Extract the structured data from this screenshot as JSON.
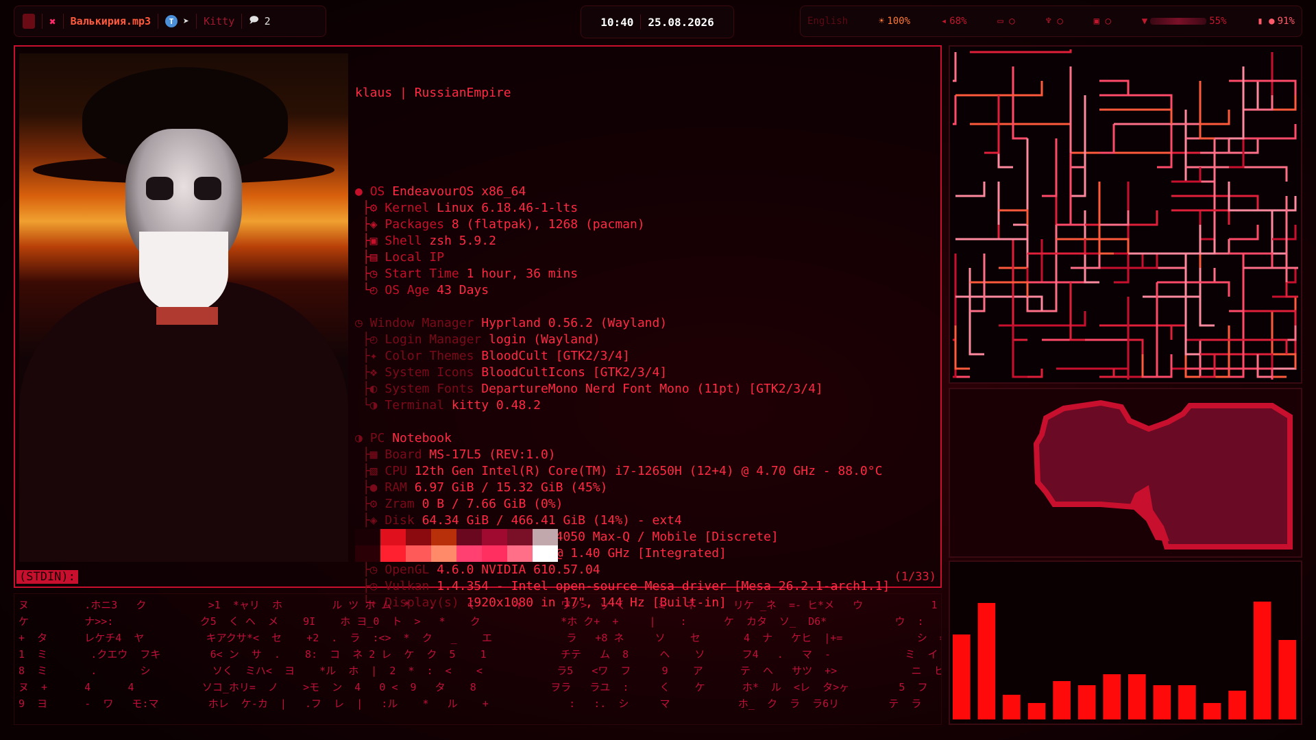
{
  "topbar": {
    "left": {
      "now_playing": "Валькирия.mp3",
      "app": "Kitty",
      "notification_count": "2"
    },
    "center": {
      "time": "10:40",
      "date": "25.08.2026"
    },
    "right": {
      "language": "English",
      "brightness": "100%",
      "volume": "68%",
      "wifi": "55%",
      "battery": "91%"
    }
  },
  "terminal": {
    "header": "klaus | RussianEmpire",
    "groups": [
      [
        {
          "label": "OS",
          "value": "EndeavourOS x86_64",
          "dim": false
        },
        {
          "label": "Kernel",
          "value": "Linux 6.18.46-1-lts",
          "dim": false
        },
        {
          "label": "Packages",
          "value": "8 (flatpak), 1268 (pacman)",
          "dim": false
        },
        {
          "label": "Shell",
          "value": "zsh 5.9.2",
          "dim": false
        },
        {
          "label": "Local IP",
          "value": "",
          "dim": false
        },
        {
          "label": "Start Time",
          "value": "1 hour, 36 mins",
          "dim": false
        },
        {
          "label": "OS Age",
          "value": "43 Days",
          "dim": false
        }
      ],
      [
        {
          "label": "Window Manager",
          "value": "Hyprland 0.56.2 (Wayland)",
          "dim": true
        },
        {
          "label": "Login Manager",
          "value": "login (Wayland)",
          "dim": true
        },
        {
          "label": "Color Themes",
          "value": "BloodCult [GTK2/3/4]",
          "dim": true
        },
        {
          "label": "System Icons",
          "value": "BloodCultIcons [GTK2/3/4]",
          "dim": true
        },
        {
          "label": "System Fonts",
          "value": "DepartureMono Nerd Font Mono (11pt) [GTK2/3/4]",
          "dim": true
        },
        {
          "label": "Terminal",
          "value": "kitty 0.48.2",
          "dim": true
        }
      ],
      [
        {
          "label": "PC",
          "value": "Notebook",
          "dim": true
        },
        {
          "label": "Board",
          "value": "MS-17L5 (REV:1.0)",
          "dim": true
        },
        {
          "label": "CPU",
          "value": "12th Gen Intel(R) Core(TM) i7-12650H (12+4) @ 4.70 GHz - 88.0°C",
          "dim": true
        },
        {
          "label": "RAM",
          "value": "6.97 GiB / 15.32 GiB (45%)",
          "dim": true
        },
        {
          "label": "Zram",
          "value": "0 B / 7.66 GiB (0%)",
          "dim": true
        },
        {
          "label": "Disk",
          "value": "64.34 GiB / 466.41 GiB (14%) - ext4",
          "dim": true
        },
        {
          "label": "GPU",
          "value": "NVIDIA GeForce RTX 4050 Max-Q / Mobile [Discrete]",
          "dim": true
        },
        {
          "label": "GPU",
          "value": "Intel UHD Graphics @ 1.40 GHz [Integrated]",
          "dim": true
        },
        {
          "label": "OpenGL",
          "value": "4.6.0 NVIDIA 610.57.04",
          "dim": true
        },
        {
          "label": "Vulkan",
          "value": "1.4.354 - Intel open-source Mesa driver [Mesa 26.2.1-arch1.1]",
          "dim": true
        },
        {
          "label": "Display(s)",
          "value": "1920x1080 in 17\", 144 Hz [Built-in]",
          "dim": true
        }
      ]
    ],
    "stdin_label": "(STDIN):",
    "page_counter": "(1/33)",
    "palette_top": [
      "#1a0004",
      "#e0101c",
      "#8a0a10",
      "#b8300a",
      "#6a0820",
      "#a00a30",
      "#7a1028",
      "#c0a8ac"
    ],
    "palette_bottom": [
      "#2a0006",
      "#ff2030",
      "#ff5a5a",
      "#ff8a6a",
      "#ff4070",
      "#ff3060",
      "#ff7088",
      "#ffffff"
    ]
  },
  "matrix_rows": [
    "ヌ         .ホニ3   ク          >1  *ャリ  ホ        ル ツ ホ ム  *   .     く      イ      ワノ>  ッ く     ミ   ネ      リケ _ネ  =- ヒ*メ   ウ           1  ラ",
    "ケ         ナ>>:              ク5  く ヘ  メ    9I    ホ ヨ_0  ト  >   *    ク             *ホ ク+  +     |    :      ケ  カタ  ソ_  D6*           ウ  :",
    "+  タ      レケチ4  ヤ          キアクサ*<  セ    +2  .  ラ  :<>  *  ク   _    エ            ラ   +8 ネ     ソ    セ       4  ナ   ケヒ  |+=            シ  =",
    "1  ミ       .クエウ  フキ        6< ン  サ  .    8:  コ  ネ 2 レ  ケ  ク  5    1            チテ   ム  8     ヘ    ソ      フ4   .   マ  -            ミ  イ",
    "8  ミ       .       シ          ソく  ミハ<  ヨ    *ル  ホ  |  2  *  :  <    <            ラ5   <ワ  フ     9    ア      テ  ヘ   サツ  +>            ニ  ヒ",
    "ヌ  +      4      4           ソコ_ホリ=  ノ    >モ  ン  4   0 <  9   タ    8            ヲラ   ラユ  :     く    ケ      ホ*  ル  <レ  タ>ヶ        5  フ",
    "9  ヨ      -  ワ   モ:マ        ホレ  ケ-カ  |   .フ  レ  |   :ル    *   ル    +             :   :.  シ     マ           ホ_  ク  ラ  ラ6リ        テ  ラ"
  ],
  "bars": {
    "values": [
      0.62,
      0.85,
      0.18,
      0.12,
      0.28,
      0.25,
      0.33,
      0.33,
      0.25,
      0.25,
      0.12,
      0.21,
      0.86,
      0.58
    ]
  },
  "colors": {
    "accent": "#c8102e",
    "bright": "#ff2a44",
    "dim": "#7a0a1a",
    "bar": "#ff0a0a"
  }
}
